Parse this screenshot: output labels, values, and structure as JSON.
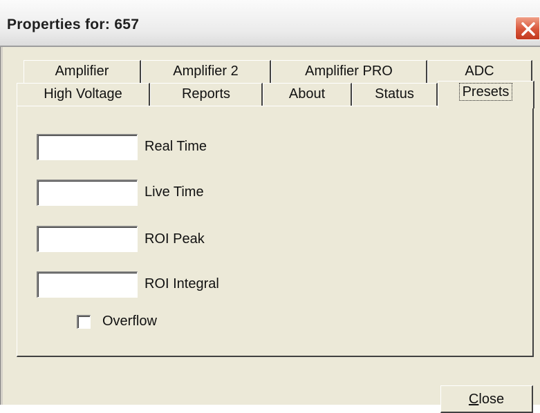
{
  "window": {
    "title": "Properties for: 657"
  },
  "tabs": {
    "back_row": [
      "Amplifier",
      "Amplifier 2",
      "Amplifier PRO",
      "ADC"
    ],
    "front_row": [
      "High Voltage",
      "Reports",
      "About",
      "Status",
      "Presets"
    ],
    "active": "Presets"
  },
  "presets": {
    "real_time": {
      "label": "Real Time",
      "value": ""
    },
    "live_time": {
      "label": "Live Time",
      "value": ""
    },
    "roi_peak": {
      "label": "ROI Peak",
      "value": ""
    },
    "roi_integral": {
      "label": "ROI Integral",
      "value": ""
    },
    "overflow": {
      "label": "Overflow",
      "checked": false
    }
  },
  "buttons": {
    "close_first": "C",
    "close_rest": "lose"
  },
  "icons": {
    "window_close": "close-icon"
  },
  "colors": {
    "close_button_red": "#d8553a",
    "face": "#ece9d8"
  }
}
